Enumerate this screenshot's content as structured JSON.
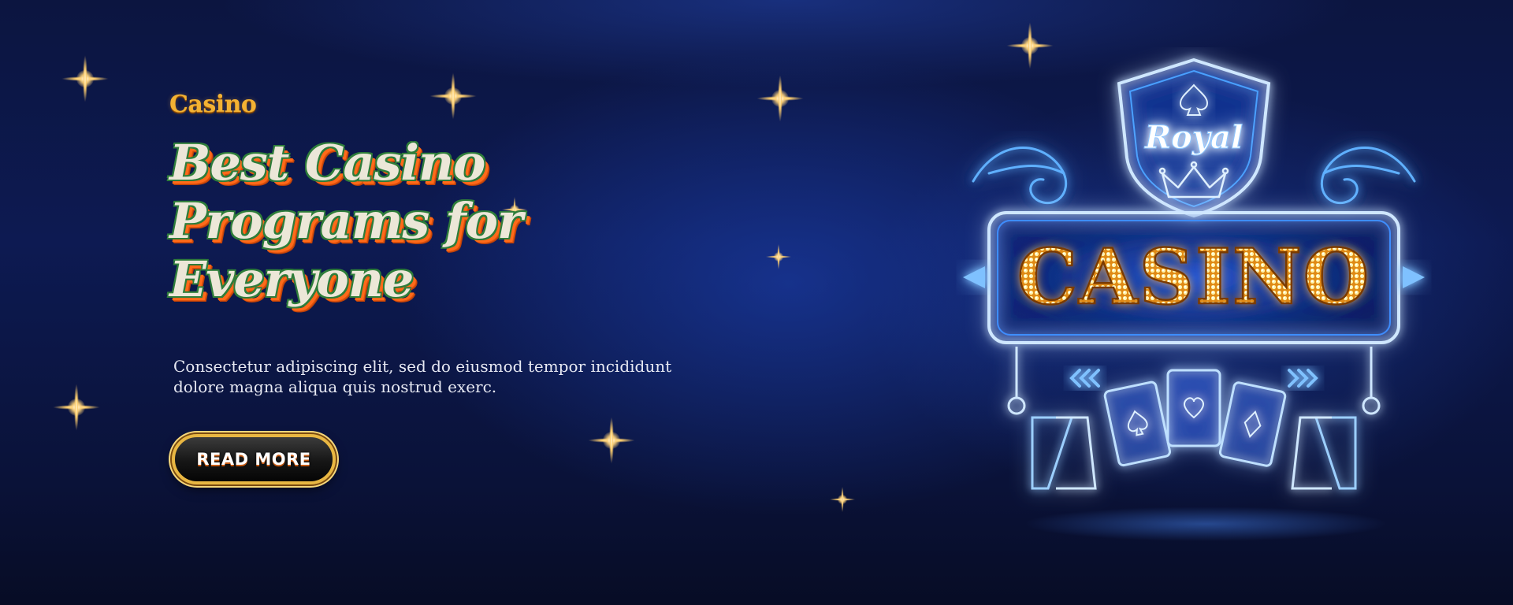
{
  "brand": {
    "label": "Casino"
  },
  "hero": {
    "headline": "Best Casino Programs for Everyone",
    "body": "Consectetur adipiscing elit, sed do eiusmod tempor incididunt dolore magna aliqua quis nostrud exerc.",
    "cta_label": "READ MORE"
  },
  "sign": {
    "shield_label": "Royal",
    "main_label": "CASINO"
  },
  "icons": {
    "spade": "spade-icon",
    "crown": "crown-icon",
    "cards": "playing-cards-icon",
    "sparkle": "sparkle-icon"
  },
  "colors": {
    "background": "#0c1540",
    "gold": "#f3b233",
    "headline_fill": "#ece7d8",
    "headline_outline": "#2e7d3a",
    "headline_shadow": "#ff6a1a",
    "neon_blue": "#3fa0ff",
    "neon_white": "#dff0ff",
    "bulb_gold": "#ffc431"
  }
}
